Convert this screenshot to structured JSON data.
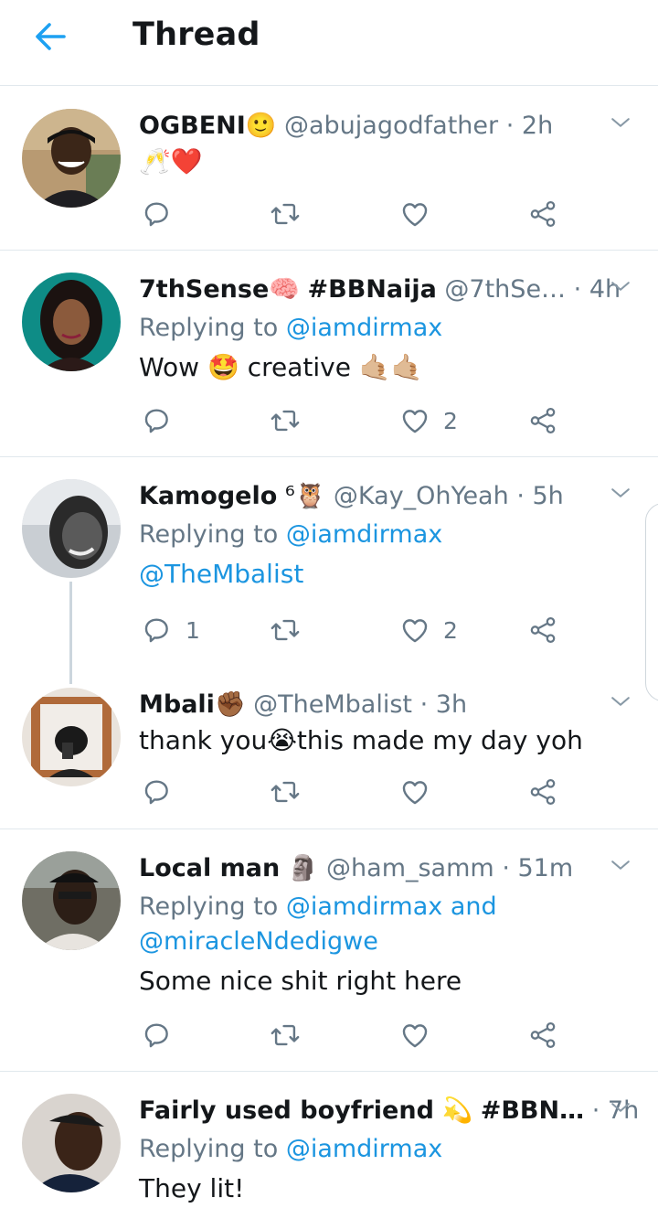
{
  "header": {
    "title": "Thread"
  },
  "tweets": [
    {
      "name": "OGBENI",
      "name_emoji": "🙂",
      "handle": "@abujagodfather",
      "sep": "·",
      "time": "2h",
      "reply_prefix": "",
      "reply_mentions": "",
      "body": "🥂❤️",
      "reply_count": "",
      "retweet_count": "",
      "like_count": ""
    },
    {
      "name": "7thSense",
      "name_emoji": "🧠",
      "name_extra": "#BBNaija",
      "handle": "@7thSe…",
      "sep": "·",
      "time": "4h",
      "reply_prefix": "Replying to",
      "reply_mentions": "@iamdirmax",
      "body": "Wow 🤩 creative 🤙🏼🤙🏼",
      "reply_count": "",
      "retweet_count": "",
      "like_count": "2"
    },
    {
      "name": "Kamogelo",
      "name_emoji": "⁶🦉",
      "handle": "@Kay_OhYeah",
      "sep": "·",
      "time": "5h",
      "reply_prefix": "Replying to",
      "reply_mentions": "@iamdirmax",
      "body": "@TheMbalist",
      "reply_count": "1",
      "retweet_count": "",
      "like_count": "2"
    },
    {
      "name": "Mbali",
      "name_emoji": "✊🏾",
      "handle": "@TheMbalist",
      "sep": "·",
      "time": "3h",
      "reply_prefix": "",
      "reply_mentions": "",
      "body": "thank you😭this made my day yoh",
      "reply_count": "",
      "retweet_count": "",
      "like_count": ""
    },
    {
      "name": "Local man",
      "name_emoji": "🗿",
      "handle": "@ham_samm",
      "sep": "·",
      "time": "51m",
      "reply_prefix": "Replying to",
      "reply_mentions": "@iamdirmax and",
      "reply_mentions_2": "@miracleNdedigwe",
      "body": "Some nice shit right here",
      "reply_count": "",
      "retweet_count": "",
      "like_count": ""
    },
    {
      "name": "Fairly used boyfriend",
      "name_emoji": "💫",
      "name_extra": "#BBN…",
      "handle": "",
      "sep": "·",
      "time": "7h",
      "reply_prefix": "Replying to",
      "reply_mentions": "@iamdirmax",
      "body": "They lit!",
      "reply_count": "",
      "retweet_count": "",
      "like_count": ""
    }
  ],
  "colors": {
    "accent": "#1da1f2",
    "link": "#1b95e0",
    "muted": "#657786",
    "divider": "#e1e8ed"
  },
  "icons": [
    "back-arrow-icon",
    "chevron-down-icon",
    "reply-icon",
    "retweet-icon",
    "like-icon",
    "share-icon"
  ]
}
